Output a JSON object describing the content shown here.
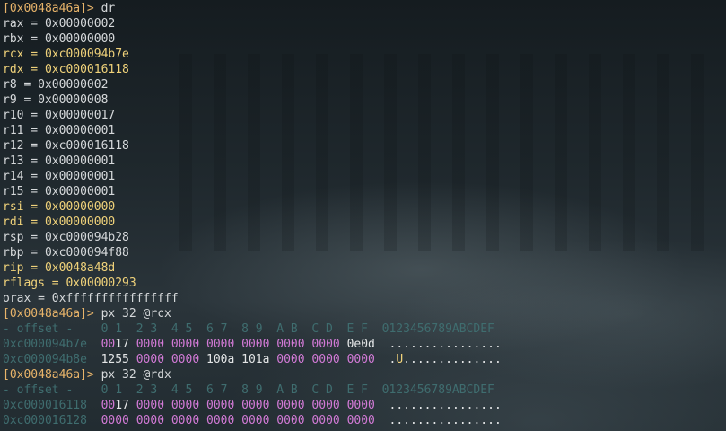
{
  "prompt1": "[0x0048a46a]>",
  "cmd1": " dr",
  "registers": [
    {
      "text": "rax = 0x00000002",
      "hl": false
    },
    {
      "text": "rbx = 0x00000000",
      "hl": false
    },
    {
      "text": "rcx = 0xc000094b7e",
      "hl": true
    },
    {
      "text": "rdx = 0xc000016118",
      "hl": true
    },
    {
      "text": "r8 = 0x00000002",
      "hl": false
    },
    {
      "text": "r9 = 0x00000008",
      "hl": false
    },
    {
      "text": "r10 = 0x00000017",
      "hl": false
    },
    {
      "text": "r11 = 0x00000001",
      "hl": false
    },
    {
      "text": "r12 = 0xc000016118",
      "hl": false
    },
    {
      "text": "r13 = 0x00000001",
      "hl": false
    },
    {
      "text": "r14 = 0x00000001",
      "hl": false
    },
    {
      "text": "r15 = 0x00000001",
      "hl": false
    },
    {
      "text": "rsi = 0x00000000",
      "hl": true
    },
    {
      "text": "rdi = 0x00000000",
      "hl": true
    },
    {
      "text": "rsp = 0xc000094b28",
      "hl": false
    },
    {
      "text": "rbp = 0xc000094f88",
      "hl": false
    },
    {
      "text": "rip = 0x0048a48d",
      "hl": true
    },
    {
      "text": "rflags = 0x00000293",
      "hl": true
    },
    {
      "text": "orax = 0xffffffffffffffff",
      "hl": false
    }
  ],
  "prompt2": "[0x0048a46a]>",
  "cmd2": " px 32 @rcx",
  "header": "- offset -    0 1  2 3  4 5  6 7  8 9  A B  C D  E F  0123456789ABCDEF",
  "dump1": [
    {
      "addr": "0xc000094b7e",
      "hex": [
        [
          "00",
          "17"
        ],
        "0000",
        "0000",
        "0000",
        "0000",
        "0000",
        "0000",
        "0e0d"
      ],
      "ascii": "................"
    },
    {
      "addr": "0xc000094b8e",
      "hex": [
        [
          "12",
          "55"
        ],
        "0000",
        "0000",
        "100a",
        "101a",
        "0000",
        "0000",
        "0000"
      ],
      "ascii": ".U.............."
    }
  ],
  "prompt3": "[0x0048a46a]>",
  "cmd3": " px 32 @rdx",
  "dump2": [
    {
      "addr": "0xc000016118",
      "hex": [
        [
          "00",
          "17"
        ],
        "0000",
        "0000",
        "0000",
        "0000",
        "0000",
        "0000",
        "0000"
      ],
      "ascii": "................"
    },
    {
      "addr": "0xc000016128",
      "hex": [
        "0000",
        "0000",
        "0000",
        "0000",
        "0000",
        "0000",
        "0000",
        "0000"
      ],
      "ascii": "................"
    }
  ],
  "colors": {
    "prompt": "#e8b46a",
    "highlight": "#f0d27a",
    "dim": "#3f6d6f",
    "hex_zero": "#d27ad6",
    "text": "#d6d9db"
  }
}
